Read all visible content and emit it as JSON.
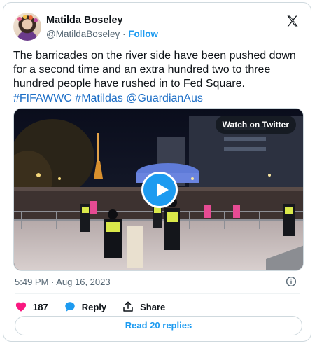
{
  "author": {
    "name": "Matilda Boseley",
    "handle": "@MatildaBoseley",
    "separator": "·",
    "follow_label": "Follow"
  },
  "tweet": {
    "text_plain": "The barricades on the river side have been pushed down for a second time and an extra hundred two to three hundred people have rushed in to Fed Square.",
    "hashtag1": "#FIFAWWC",
    "hashtag2": "#Matildas",
    "mention": "@GuardianAus"
  },
  "media": {
    "watch_label": "Watch on Twitter",
    "play_icon": "play-icon"
  },
  "meta": {
    "timestamp": "5:49 PM · Aug 16, 2023"
  },
  "actions": {
    "likes_count": "187",
    "reply_label": "Reply",
    "share_label": "Share"
  },
  "replies_button": "Read 20 replies",
  "colors": {
    "accent": "#1d9bf0",
    "heart": "#f91880"
  }
}
